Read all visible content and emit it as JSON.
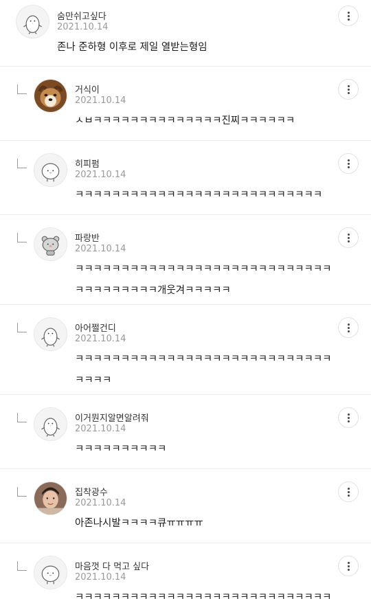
{
  "comments": [
    {
      "nick": "숨만쉬고싶다",
      "date": "2021.10.14",
      "lines": [
        "존나 준하형 이후로 제일 열받는형임"
      ],
      "avatar": "penguin-avatar"
    },
    {
      "nick": "거식이",
      "date": "2021.10.14",
      "lines": [
        "ㅅㅂㅋㅋㅋㅋㅋㅋㅋㅋㅋㅋㅋㅋㅋㅋ진찌ㅋㅋㅋㅋㅋㅋ"
      ],
      "avatar": "puppy-photo-avatar"
    },
    {
      "nick": "히피펌",
      "date": "2021.10.14",
      "lines": [
        "ㅋㅋㅋㅋㅋㅋㅋㅋㅋㅋㅋㅋㅋㅋㅋㅋㅋㅋㅋㅋㅋㅋㅋㅋㅋㅋㅋ"
      ],
      "avatar": "blob-avatar"
    },
    {
      "nick": "파랑반",
      "date": "2021.10.14",
      "lines": [
        "ㅋㅋㅋㅋㅋㅋㅋㅋㅋㅋㅋㅋㅋㅋㅋㅋㅋㅋㅋㅋㅋㅋㅋㅋㅋㅋㅋㅋ",
        "ㅋㅋㅋㅋㅋㅋㅋㅋㅋ개웃겨ㅋㅋㅋㅋㅋ"
      ],
      "avatar": "bear-avatar"
    },
    {
      "nick": "아어쩔건디",
      "date": "2021.10.14",
      "lines": [
        "ㅋㅋㅋㅋㅋㅋㅋㅋㅋㅋㅋㅋㅋㅋㅋㅋㅋㅋㅋㅋㅋㅋㅋㅋㅋㅋㅋㅋ",
        "ㅋㅋㅋㅋ"
      ],
      "avatar": "penguin-avatar"
    },
    {
      "nick": "이거뭔지알면알려줘",
      "date": "2021.10.14",
      "lines": [
        "ㅋㅋㅋㅋㅋㅋㅋㅋㅋㅋ"
      ],
      "avatar": "penguin-avatar"
    },
    {
      "nick": "집착광수",
      "date": "2021.10.14",
      "lines": [
        "아존나시발ㅋㅋㅋㅋ큐ㅠㅠㅠㅠ"
      ],
      "avatar": "person-photo-avatar"
    },
    {
      "nick": "마음껏 다 먹고 싶다",
      "date": "2021.10.14",
      "lines": [
        "ㅋㅋㅋㅋㅋㅋㅋㅋㅋㅋㅋㅋㅋㅋㅋㅋㅋㅋㅋㅋㅋㅋㅋㅋㅋㅋㅋㅋ"
      ],
      "avatar": "blob-avatar"
    }
  ]
}
